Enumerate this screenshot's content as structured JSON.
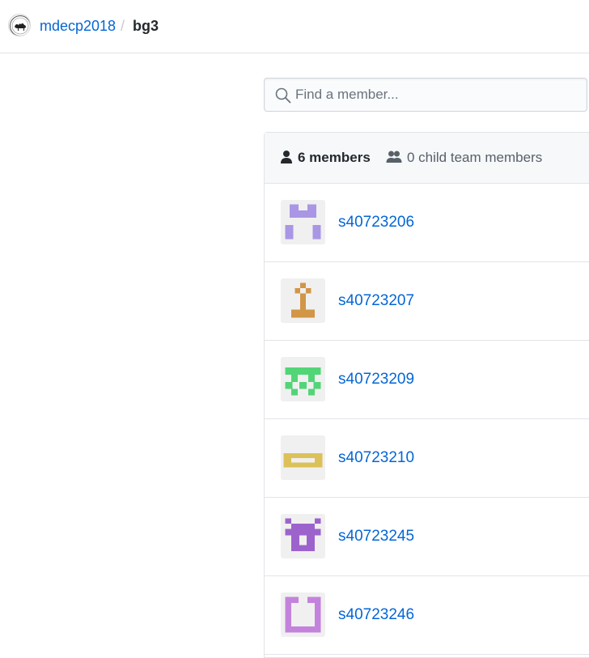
{
  "breadcrumb": {
    "org_name": "mdecp2018",
    "separator": "/",
    "team_name": "bg3"
  },
  "search": {
    "placeholder": "Find a member...",
    "value": "",
    "icon": "search-icon"
  },
  "members_header": {
    "members_label": "6 members",
    "child_label": "0 child team members"
  },
  "members": [
    {
      "login": "s40723206",
      "identicon_color": "#a996e4"
    },
    {
      "login": "s40723207",
      "identicon_color": "#d29647"
    },
    {
      "login": "s40723209",
      "identicon_color": "#52d577"
    },
    {
      "login": "s40723210",
      "identicon_color": "#dcc15a"
    },
    {
      "login": "s40723245",
      "identicon_color": "#9c63cd"
    },
    {
      "login": "s40723246",
      "identicon_color": "#c383dc"
    }
  ],
  "colors": {
    "link": "#0366d6",
    "border": "#e1e4e8",
    "header_bg": "#f6f8fa"
  }
}
